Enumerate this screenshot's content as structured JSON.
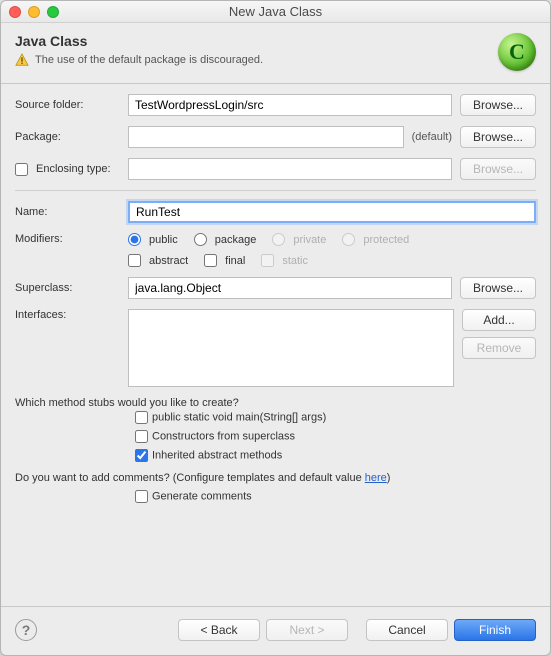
{
  "window": {
    "title": "New Java Class"
  },
  "header": {
    "heading": "Java Class",
    "warning": "The use of the default package is discouraged."
  },
  "form": {
    "source_folder": {
      "label": "Source folder:",
      "value": "TestWordpressLogin/src",
      "browse": "Browse..."
    },
    "package": {
      "label": "Package:",
      "value": "",
      "suffix": "(default)",
      "browse": "Browse..."
    },
    "enclosing": {
      "label": "Enclosing type:",
      "value": "",
      "browse": "Browse..."
    },
    "name": {
      "label": "Name:",
      "value": "RunTest"
    },
    "modifiers": {
      "label": "Modifiers:",
      "public": "public",
      "package": "package",
      "private": "private",
      "protected": "protected",
      "abstract": "abstract",
      "final": "final",
      "static": "static"
    },
    "superclass": {
      "label": "Superclass:",
      "value": "java.lang.Object",
      "browse": "Browse..."
    },
    "interfaces": {
      "label": "Interfaces:",
      "add": "Add...",
      "remove": "Remove"
    },
    "stubs": {
      "question": "Which method stubs would you like to create?",
      "main": "public static void main(String[] args)",
      "constructors": "Constructors from superclass",
      "inherited": "Inherited abstract methods"
    },
    "comments": {
      "question_prefix": "Do you want to add comments? (Configure templates and default value ",
      "here": "here",
      "question_suffix": ")",
      "generate": "Generate comments"
    }
  },
  "footer": {
    "back": "< Back",
    "next": "Next >",
    "cancel": "Cancel",
    "finish": "Finish"
  }
}
